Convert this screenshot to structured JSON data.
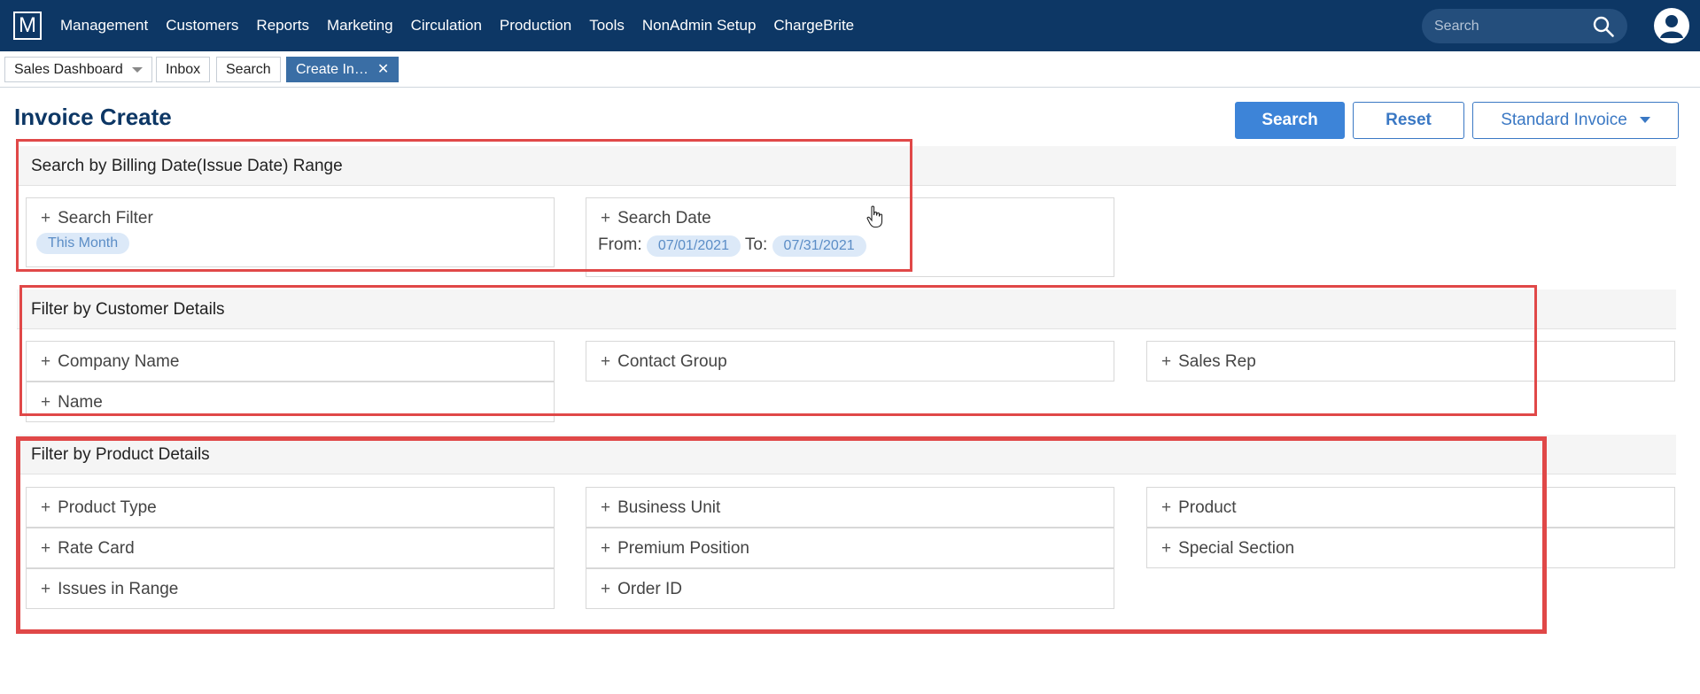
{
  "nav": {
    "logo": "M",
    "items": [
      "Management",
      "Customers",
      "Reports",
      "Marketing",
      "Circulation",
      "Production",
      "Tools",
      "NonAdmin Setup",
      "ChargeBrite"
    ],
    "search_placeholder": "Search"
  },
  "tabs": {
    "sales_dashboard": "Sales Dashboard",
    "inbox": "Inbox",
    "search": "Search",
    "create_invoice": "Create In…",
    "close": "✕"
  },
  "header": {
    "title": "Invoice Create",
    "search_button": "Search",
    "reset_button": "Reset",
    "type_dropdown": "Standard Invoice"
  },
  "sections": {
    "billing": {
      "title": "Search by Billing Date(Issue Date) Range",
      "search_filter": {
        "label": "Search Filter",
        "value": "This Month"
      },
      "search_date": {
        "label": "Search Date",
        "from_label": "From:",
        "from_value": "07/01/2021",
        "to_label": "To:",
        "to_value": "07/31/2021"
      }
    },
    "customer": {
      "title": "Filter by Customer Details",
      "fields": [
        "Company Name",
        "Contact Group",
        "Sales Rep",
        "Name"
      ]
    },
    "product": {
      "title": "Filter by Product Details",
      "fields": [
        "Product Type",
        "Business Unit",
        "Product",
        "Rate Card",
        "Premium Position",
        "Special Section",
        "Issues in Range",
        "Order ID"
      ]
    }
  },
  "plus_symbol": "+",
  "colors": {
    "nav_bg": "#0d3765",
    "primary": "#3d84d8",
    "chip_bg": "#dce9f8",
    "highlight": "#e04848"
  }
}
